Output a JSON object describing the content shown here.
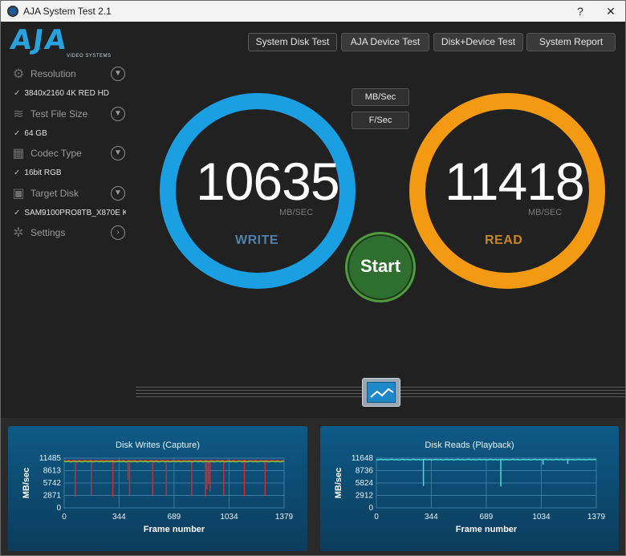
{
  "window": {
    "title": "AJA System Test 2.1",
    "help": "?",
    "close": "✕"
  },
  "logo": {
    "text": "AJA",
    "subtext": "VIDEO SYSTEMS"
  },
  "sidebar": {
    "items": [
      {
        "label": "Resolution",
        "value": "3840x2160 4K RED HD",
        "icon": "resolution-icon"
      },
      {
        "label": "Test File Size",
        "value": "64 GB",
        "icon": "file-size-icon"
      },
      {
        "label": "Codec Type",
        "value": "16bit RGB",
        "icon": "codec-icon"
      },
      {
        "label": "Target Disk",
        "value": "SAM9100PRO8TB_X870E K",
        "icon": "disk-icon"
      },
      {
        "label": "Settings",
        "value": null,
        "icon": "settings-icon"
      }
    ],
    "check": "✓"
  },
  "tabs": [
    {
      "label": "System Disk Test",
      "active": true
    },
    {
      "label": "AJA Device Test",
      "active": false
    },
    {
      "label": "Disk+Device Test",
      "active": false
    },
    {
      "label": "System Report",
      "active": false
    }
  ],
  "units": {
    "mbsec": "MB/Sec",
    "fsec": "F/Sec"
  },
  "write": {
    "value": "10635",
    "unit": "MB/SEC",
    "label": "WRITE",
    "color": "#1aa0e2"
  },
  "read": {
    "value": "11418",
    "unit": "MB/SEC",
    "label": "READ",
    "color": "#f39a12"
  },
  "start": {
    "label": "Start"
  },
  "chart_data": [
    {
      "type": "line",
      "title": "Disk Writes (Capture)",
      "xlabel": "Frame number",
      "ylabel": "MB/sec",
      "xlim": [
        0,
        1379
      ],
      "ylim": [
        0,
        11485
      ],
      "xticks": [
        0,
        344,
        689,
        1034,
        1379
      ],
      "yticks": [
        0,
        2871,
        5742,
        8613,
        11485
      ],
      "grid": true,
      "series": [
        {
          "color": "#d42a2a",
          "baseline": 10900,
          "dips": [
            [
              70,
              2500
            ],
            [
              170,
              2800
            ],
            [
              305,
              2600
            ],
            [
              410,
              3000
            ],
            [
              400,
              6500
            ],
            [
              555,
              2900
            ],
            [
              640,
              2800
            ],
            [
              800,
              2700
            ],
            [
              885,
              2600
            ],
            [
              895,
              4200
            ],
            [
              905,
              5500
            ],
            [
              915,
              3800
            ],
            [
              1000,
              2900
            ],
            [
              1130,
              2700
            ],
            [
              1260,
              2800
            ]
          ]
        },
        {
          "color": "#7ac943",
          "baseline": 10700,
          "dips": []
        }
      ]
    },
    {
      "type": "line",
      "title": "Disk Reads (Playback)",
      "xlabel": "Frame number",
      "ylabel": "MB/sec",
      "xlim": [
        0,
        1379
      ],
      "ylim": [
        0,
        11648
      ],
      "xticks": [
        0,
        344,
        689,
        1034,
        1379
      ],
      "yticks": [
        0,
        2912,
        5824,
        8736,
        11648
      ],
      "grid": true,
      "series": [
        {
          "color": "#4dd9d9",
          "baseline": 11300,
          "dips": [
            [
              295,
              5100
            ],
            [
              780,
              5000
            ],
            [
              1045,
              10100
            ],
            [
              1200,
              10300
            ]
          ]
        }
      ]
    }
  ]
}
